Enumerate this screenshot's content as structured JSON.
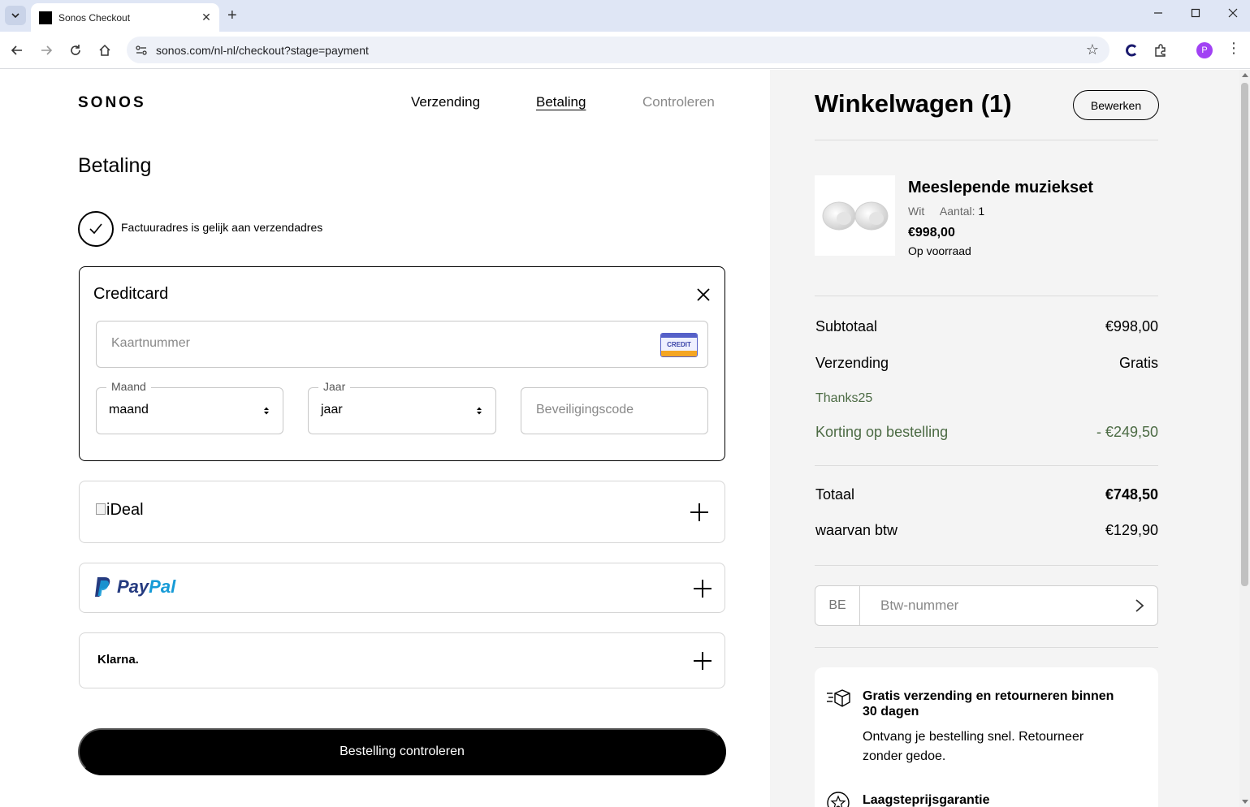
{
  "browser": {
    "tab_title": "Sonos Checkout",
    "url": "sonos.com/nl-nl/checkout?stage=payment",
    "profile_initial": "P"
  },
  "header": {
    "logo": "SONOS",
    "steps": [
      "Verzending",
      "Betaling",
      "Controleren"
    ],
    "active_step": "Betaling"
  },
  "payment": {
    "title": "Betaling",
    "billing_same_label": "Factuuradres is gelijk aan verzendadres",
    "credit_card": {
      "title": "Creditcard",
      "card_number_placeholder": "Kaartnummer",
      "card_badge": "CREDIT",
      "month_label": "Maand",
      "month_value": "maand",
      "year_label": "Jaar",
      "year_value": "jaar",
      "cvc_placeholder": "Beveiligingscode"
    },
    "methods": {
      "ideal": "iDeal",
      "paypal_pay": "Pay",
      "paypal_pal": "Pal",
      "klarna": "Klarna."
    },
    "cta": "Bestelling controleren"
  },
  "cart": {
    "title": "Winkelwagen (1)",
    "edit_label": "Bewerken",
    "item": {
      "name": "Meeslepende muziekset",
      "color": "Wit",
      "qty_label": "Aantal:",
      "qty": "1",
      "price": "€998,00",
      "stock": "Op voorraad"
    },
    "subtotal_label": "Subtotaal",
    "subtotal_value": "€998,00",
    "shipping_label": "Verzending",
    "shipping_value": "Gratis",
    "promo_code": "Thanks25",
    "discount_label": "Korting op bestelling",
    "discount_value": "- €249,50",
    "total_label": "Totaal",
    "total_value": "€748,50",
    "vat_label": "waarvan btw",
    "vat_value": "€129,90",
    "vat_country": "BE",
    "vat_placeholder": "Btw-nummer",
    "benefits": [
      {
        "title": "Gratis verzending en retourneren binnen 30 dagen",
        "text": "Ontvang je bestelling snel. Retourneer zonder gedoe.",
        "icon": "delivery-box-icon"
      },
      {
        "title": "Laagsteprijsgarantie",
        "icon": "price-star-icon"
      }
    ]
  },
  "colors": {
    "accent_green": "#4c6b44",
    "cta_black": "#000000",
    "paypal_dark": "#253b80",
    "paypal_light": "#179bd7"
  }
}
